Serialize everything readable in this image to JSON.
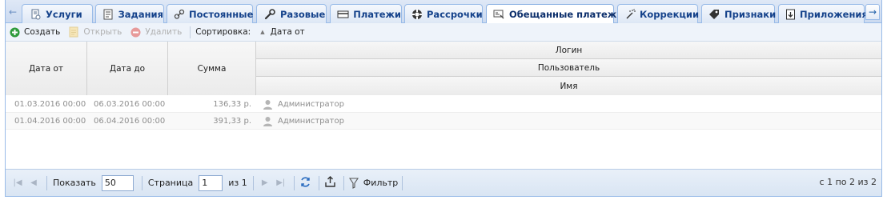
{
  "tabs": [
    {
      "label": "Услуги",
      "icon": "document-icon"
    },
    {
      "label": "Задания",
      "icon": "task-list-icon"
    },
    {
      "label": "Постоянные",
      "icon": "link-icon"
    },
    {
      "label": "Разовые",
      "icon": "wrench-icon"
    },
    {
      "label": "Платежи",
      "icon": "card-icon"
    },
    {
      "label": "Рассрочки",
      "icon": "lifebuoy-icon"
    },
    {
      "label": "Обещанные платежи",
      "icon": "promise-icon",
      "active": true
    },
    {
      "label": "Коррекции",
      "icon": "wand-icon"
    },
    {
      "label": "Признаки",
      "icon": "tag-icon"
    },
    {
      "label": "Приложения",
      "icon": "attachment-icon"
    }
  ],
  "toolbar": {
    "create_label": "Создать",
    "open_label": "Открыть",
    "delete_label": "Удалить",
    "sort_caption": "Сортировка:",
    "sort_field": "Дата от"
  },
  "grid": {
    "columns": {
      "date_from": "Дата от",
      "date_to": "Дата до",
      "sum": "Сумма",
      "login": "Логин",
      "user": "Пользователь",
      "name": "Имя"
    },
    "rows": [
      {
        "date_from": "01.03.2016 00:00",
        "date_to": "06.03.2016 00:00",
        "sum": "136,33 р.",
        "user": "Администратор"
      },
      {
        "date_from": "01.04.2016 00:00",
        "date_to": "06.04.2016 00:00",
        "sum": "391,33 р.",
        "user": "Администратор"
      }
    ]
  },
  "pager": {
    "show_label": "Показать",
    "page_size": "50",
    "page_label": "Страница",
    "page": "1",
    "of_label": "из 1",
    "filter_label": "Фильтр",
    "info": "с 1 по 2 из 2"
  },
  "colors": {
    "accent": "#15428b",
    "border": "#99bbe8",
    "create_icon": "#2e9b3c",
    "delete_icon": "#e06a6a"
  }
}
